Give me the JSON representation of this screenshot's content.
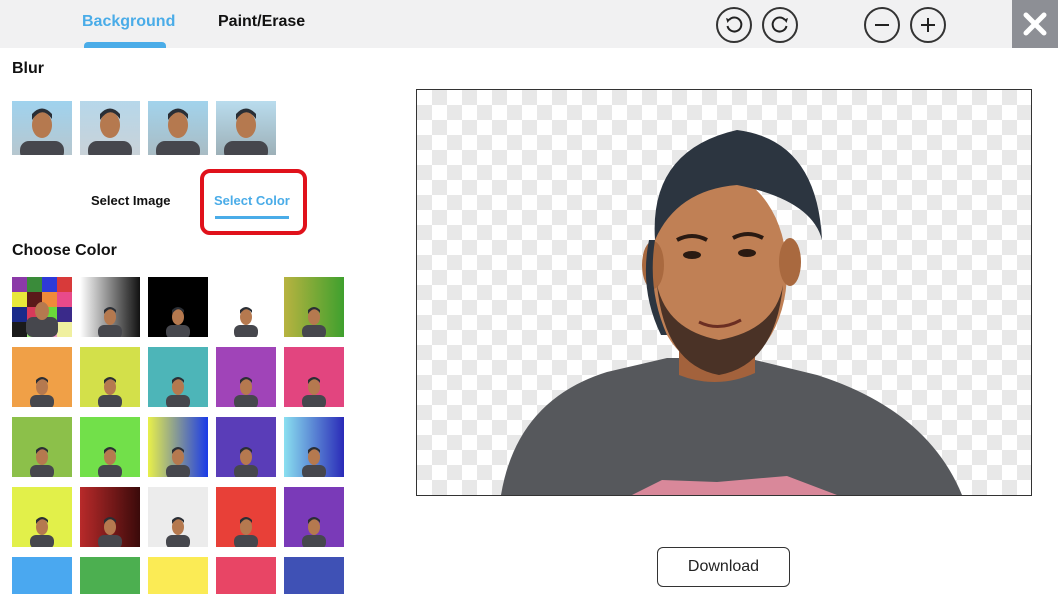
{
  "tabs": {
    "background": "Background",
    "paint_erase": "Paint/Erase"
  },
  "toolbar": {
    "undo_icon": "undo-icon",
    "redo_icon": "redo-icon",
    "zoom_out_icon": "minus-icon",
    "zoom_in_icon": "plus-icon",
    "close_icon": "close-icon"
  },
  "blur": {
    "title": "Blur",
    "thumbnails": 4
  },
  "source_tabs": {
    "select_image": "Select Image",
    "select_color": "Select Color"
  },
  "color_section": {
    "title": "Choose Color"
  },
  "swatches": [
    "palette-grid",
    "gradient-white-black",
    "#000000",
    "transparent",
    "gradient-olive-green",
    "#f0a047",
    "#d3e04a",
    "#4db5b8",
    "#a044b8",
    "#e2457f",
    "#8cc04a",
    "#72e04a",
    "gradient-yellow-blue",
    "#5a3db8",
    "gradient-cyan-navy",
    "#e2f04a",
    "gradient-darkred",
    "#ececec",
    "#e84038",
    "#7a3ab8",
    "#4aa8f0",
    "#4caf50",
    "#fbeb55",
    "#e84565",
    "#3f51b5"
  ],
  "actions": {
    "download": "Download"
  },
  "colors": {
    "accent": "#4aace8",
    "highlight": "#e0111b",
    "topbar": "#f1f1f2"
  }
}
